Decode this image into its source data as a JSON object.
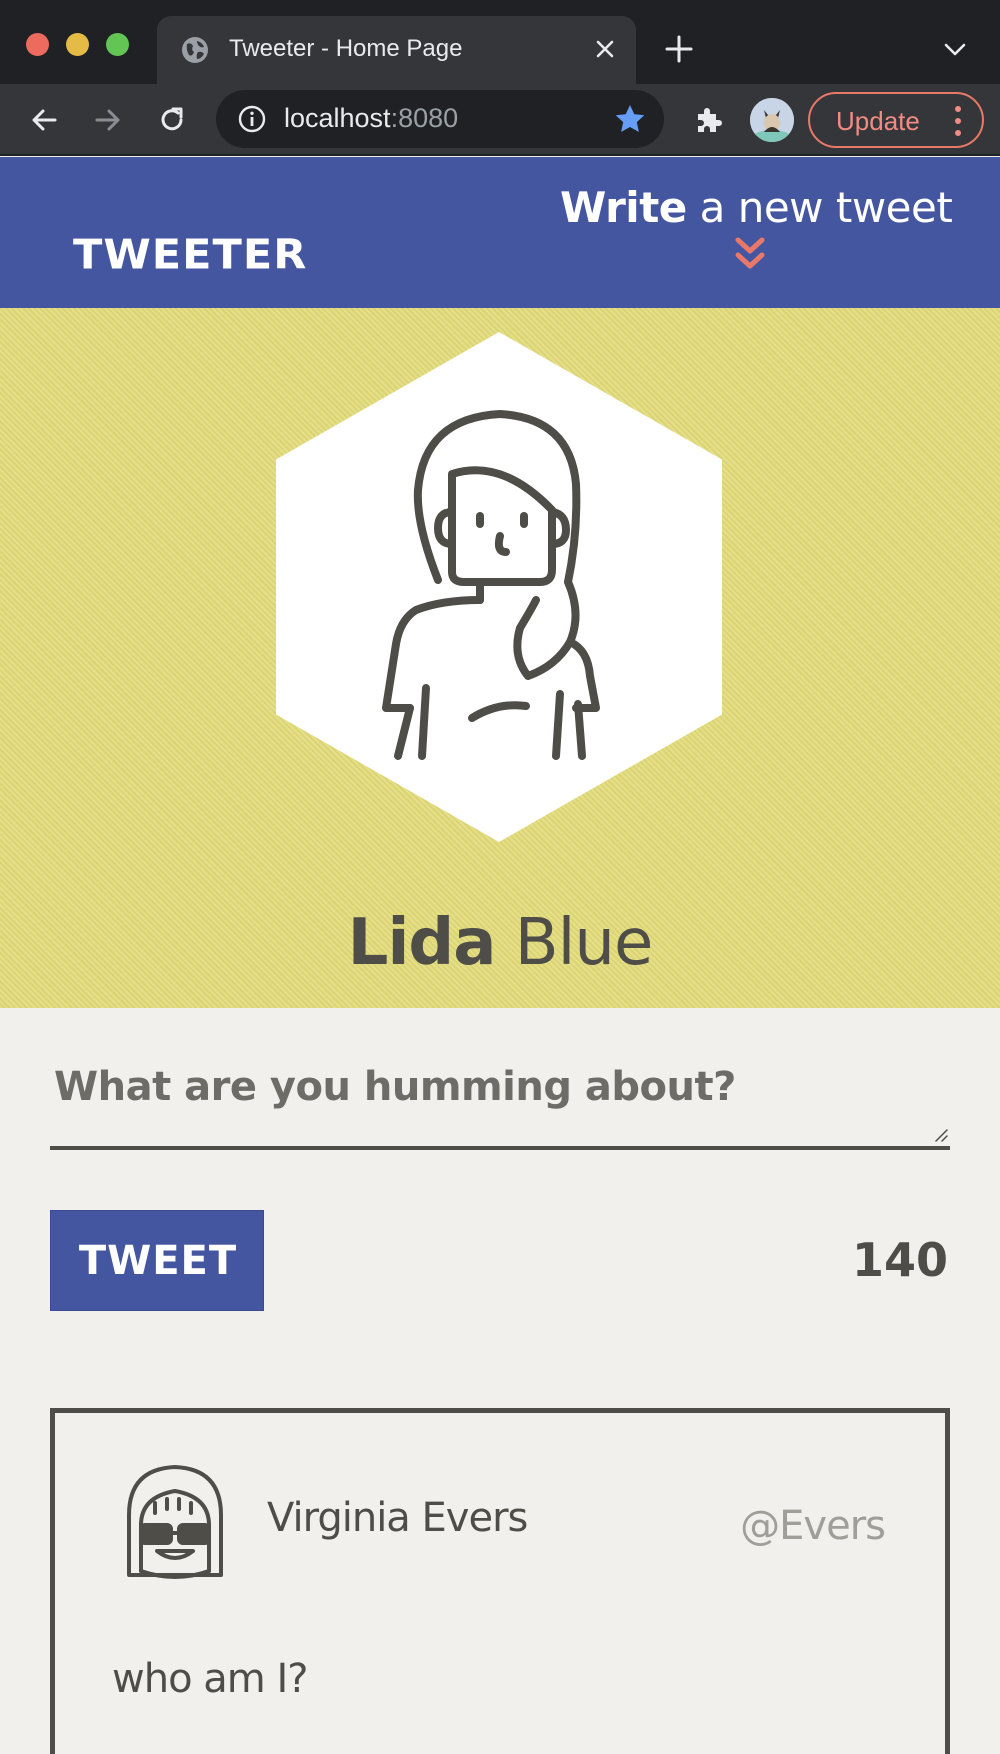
{
  "browser": {
    "tab_title": "Tweeter - Home Page",
    "url_host": "localhost",
    "url_port": ":8080",
    "update_label": "Update"
  },
  "navbar": {
    "brand": "TWEETER",
    "compose_bold": "Write",
    "compose_rest": " a new tweet"
  },
  "profile": {
    "first_name": "Lida",
    "last_name": " Blue"
  },
  "composer": {
    "placeholder": "What are you humming about?",
    "submit_label": "TWEET",
    "char_count": "140"
  },
  "tweets": [
    {
      "author": "Virginia Evers",
      "handle": "@Evers",
      "content": "who am I?"
    }
  ],
  "colors": {
    "navbar": "#4556a0",
    "profile_bg": "#e2db7a",
    "page_bg": "#f1f0ec",
    "accent": "#e8796a",
    "text": "#4f4d47"
  }
}
